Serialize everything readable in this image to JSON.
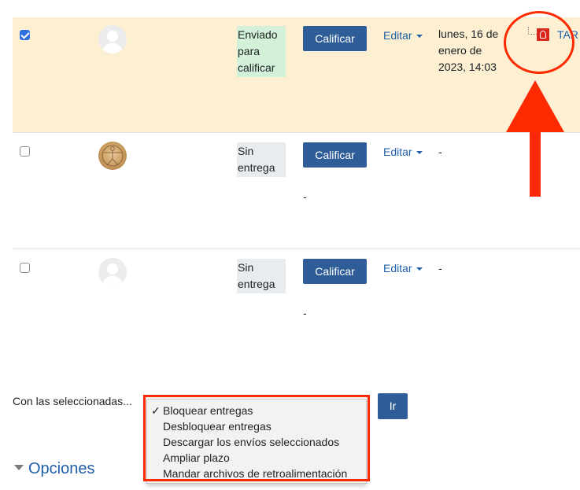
{
  "rows": [
    {
      "selected": true,
      "checked": true,
      "status": "Enviado para calificar",
      "grade_button": "Calificar",
      "edit_label": "Editar",
      "last_modified": "lunes, 16 de enero de 2023, 14:03",
      "file_name": "TAR",
      "avatar": "default-user-icon"
    },
    {
      "selected": false,
      "checked": false,
      "status": "Sin entrega",
      "grade_button": "Calificar",
      "edit_label": "Editar",
      "last_modified": "-",
      "grade_value": "-",
      "avatar": "vitruvian-man-picture"
    },
    {
      "selected": false,
      "checked": false,
      "status": "Sin entrega",
      "grade_button": "Calificar",
      "edit_label": "Editar",
      "last_modified": "-",
      "grade_value": "-",
      "avatar": "default-user-icon"
    }
  ],
  "bulk": {
    "label": "Con las seleccionadas...",
    "go_button": "Ir",
    "selected_mark": "✓",
    "options": [
      "Bloquear entregas",
      "Desbloquear entregas",
      "Descargar los envíos seleccionados",
      "Ampliar plazo",
      "Mandar archivos de retroalimentación"
    ]
  },
  "options_section": {
    "label": "Opciones"
  },
  "colors": {
    "selected_row_bg": "#fcefd2",
    "status_sent_bg": "#d3f1d9",
    "status_none_bg": "#e9ecef",
    "button_blue": "#2e5d98",
    "link_blue": "#1f5fa8",
    "annotation_red": "#ff2a00",
    "pdf_red": "#d9261c"
  }
}
